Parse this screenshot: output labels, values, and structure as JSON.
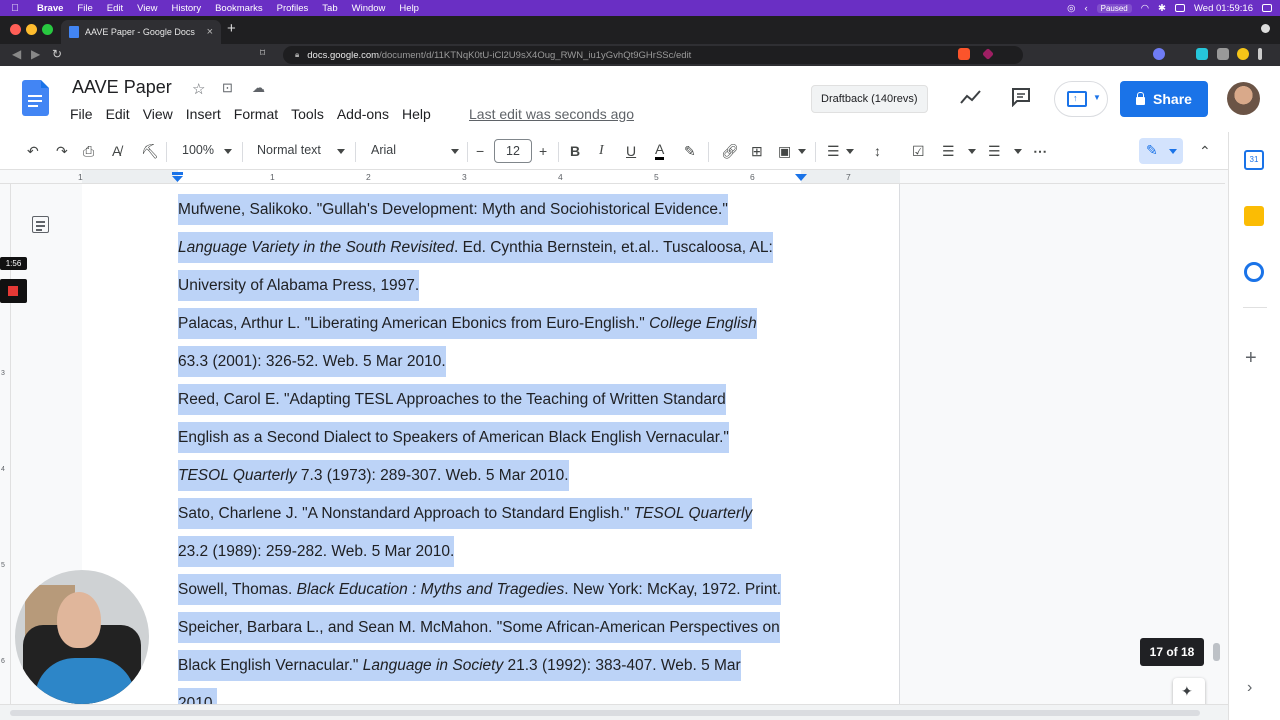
{
  "macos": {
    "app_name": "Brave",
    "menu": [
      "File",
      "Edit",
      "View",
      "History",
      "Bookmarks",
      "Profiles",
      "Tab",
      "Window",
      "Help"
    ],
    "paused_label": "Paused",
    "clock": "Wed 01:59:16"
  },
  "browser": {
    "tab_title": "AAVE Paper - Google Docs",
    "url_host": "docs.google.com",
    "url_path": "/document/d/11KTNqK0tU-iCl2U9sX4Oug_RWN_iu1yGvhQt9GHrSSc/edit"
  },
  "docs": {
    "title": "AAVE Paper",
    "menus": [
      "File",
      "Edit",
      "View",
      "Insert",
      "Format",
      "Tools",
      "Add-ons",
      "Help"
    ],
    "last_edit": "Last edit was seconds ago",
    "draftback_label": "Draftback (140revs)",
    "share_label": "Share"
  },
  "toolbar": {
    "zoom": "100%",
    "style": "Normal text",
    "font": "Arial",
    "font_size": "12"
  },
  "ruler": {
    "numbers": [
      "1",
      "1",
      "2",
      "3",
      "4",
      "5",
      "6",
      "7"
    ]
  },
  "vertical_ruler": [
    "3",
    "4",
    "5",
    "6"
  ],
  "document_lines": [
    {
      "segments": [
        {
          "text": "Mufwene, Salikoko. \"Gullah's Development: Myth and Sociohistorical Evidence.\"",
          "italic": false
        }
      ]
    },
    {
      "segments": [
        {
          "text": "Language Variety in the South Revisited",
          "italic": true
        },
        {
          "text": ". Ed. Cynthia Bernstein, et.al.. Tuscaloosa, AL:",
          "italic": false
        }
      ]
    },
    {
      "segments": [
        {
          "text": "University  of Alabama Press, 1997.",
          "italic": false
        }
      ]
    },
    {
      "segments": [
        {
          "text": "Palacas, Arthur L. \"Liberating American Ebonics from Euro-English.\" ",
          "italic": false
        },
        {
          "text": "College English",
          "italic": true
        }
      ]
    },
    {
      "segments": [
        {
          "text": "63.3 (2001): 326-52. Web. 5 Mar 2010.",
          "italic": false
        }
      ]
    },
    {
      "segments": [
        {
          "text": "Reed, Carol E. \"Adapting TESL Approaches to the Teaching of Written Standard",
          "italic": false
        }
      ]
    },
    {
      "segments": [
        {
          "text": "English as a Second Dialect to Speakers of American Black English Vernacular.\"",
          "italic": false
        }
      ]
    },
    {
      "segments": [
        {
          "text": "TESOL Quarterly",
          "italic": true
        },
        {
          "text": " 7.3 (1973): 289-307. Web. 5 Mar 2010.",
          "italic": false
        }
      ]
    },
    {
      "segments": [
        {
          "text": "Sato, Charlene J. \"A Nonstandard Approach to Standard English.\" ",
          "italic": false
        },
        {
          "text": "TESOL Quarterly",
          "italic": true
        }
      ]
    },
    {
      "segments": [
        {
          "text": "23.2 (1989): 259-282. Web. 5 Mar 2010.",
          "italic": false
        }
      ]
    },
    {
      "segments": [
        {
          "text": "Sowell, Thomas. ",
          "italic": false
        },
        {
          "text": "Black Education : Myths and Tragedies",
          "italic": true
        },
        {
          "text": ". New York: McKay, 1972. Print.",
          "italic": false
        }
      ]
    },
    {
      "segments": [
        {
          "text": "Speicher, Barbara L., and Sean M. McMahon. \"Some African-American Perspectives on",
          "italic": false
        }
      ]
    },
    {
      "segments": [
        {
          "text": "Black English Vernacular.\" ",
          "italic": false
        },
        {
          "text": "Language in Society",
          "italic": true
        },
        {
          "text": " 21.3 (1992): 383-407. Web. 5 Mar",
          "italic": false
        }
      ]
    },
    {
      "segments": [
        {
          "text": "2010.",
          "italic": false
        }
      ]
    }
  ],
  "page_indicator": "17 of 18",
  "recording_timer": "1:56",
  "colors": {
    "selection": "#bcd3f7",
    "share_button": "#1a73e8",
    "mac_menubar": "#6a2fc4"
  }
}
